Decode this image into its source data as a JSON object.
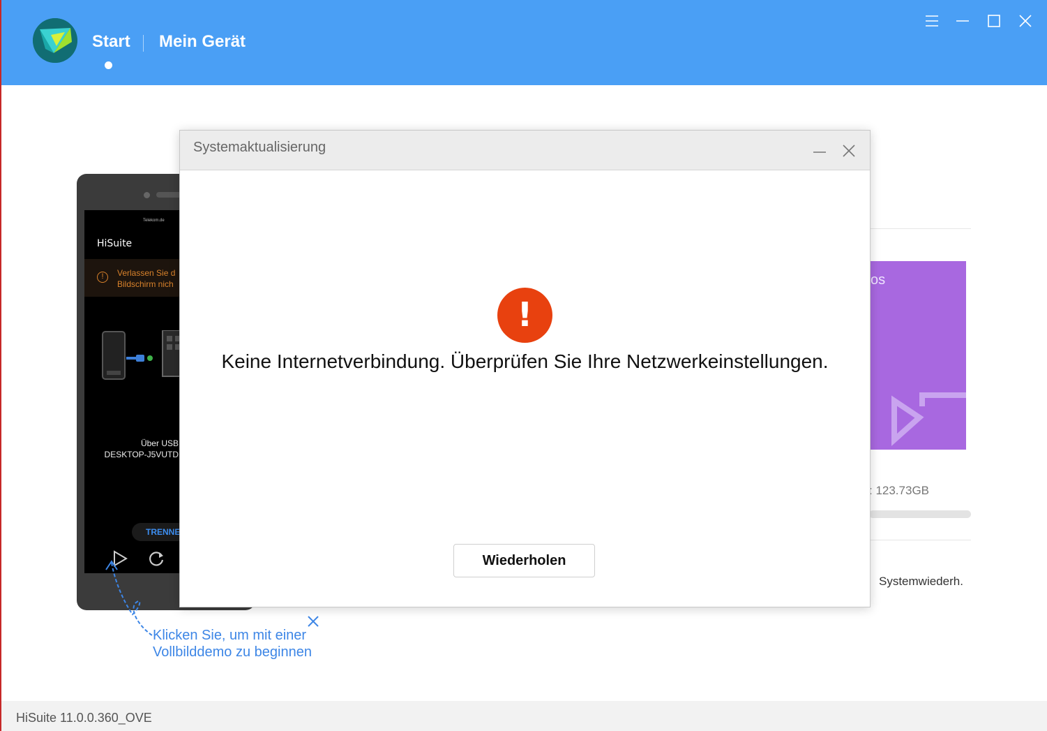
{
  "header": {
    "tabs": [
      {
        "label": "Start",
        "active": true
      },
      {
        "label": "Mein Gerät",
        "active": false
      }
    ],
    "window_controls": [
      "menu-icon",
      "minimize-icon",
      "maximize-icon",
      "close-icon"
    ],
    "background_color": "#4a9ff5"
  },
  "phone_preview": {
    "status_text": "Telekom.de",
    "app_title": "HiSuite",
    "warning_line1": "Verlassen Sie d",
    "warning_line2": "Bildschirm nich",
    "connection_line1": "Über USB",
    "connection_line2": "DESKTOP-J5VUTD",
    "disconnect_label": "TRENNE",
    "controls": [
      "play-icon",
      "refresh-icon"
    ]
  },
  "hint": {
    "text": "Klicken Sie, um mit einer Vollbilddemo zu beginnen"
  },
  "right_panel": {
    "card_label": "os",
    "card_color": "#a868e0",
    "storage_text": ": 123.73GB",
    "system_restore_label": "Systemwiederh."
  },
  "dialog": {
    "title": "Systemaktualisierung",
    "error_symbol": "!",
    "error_color": "#e8410f",
    "message": "Keine Internetverbindung. Überprüfen Sie Ihre Netzwerkeinstellungen.",
    "retry_label": "Wiederholen"
  },
  "footer": {
    "version": "HiSuite 11.0.0.360_OVE"
  }
}
